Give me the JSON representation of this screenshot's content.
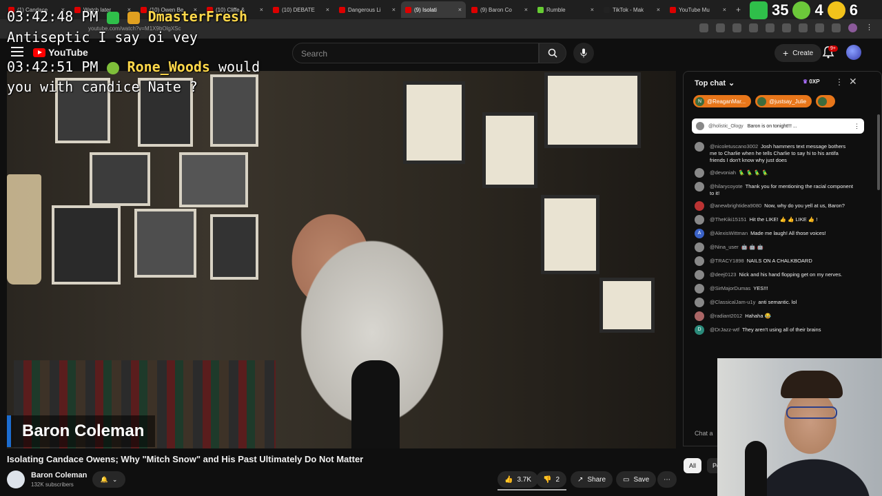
{
  "tabs": [
    {
      "label": "(1) Candace",
      "color": "#d00"
    },
    {
      "label": "Watch later",
      "color": "#d00"
    },
    {
      "label": "(10) Owen Be",
      "color": "#d00"
    },
    {
      "label": "(10) Cliffe &",
      "color": "#d00"
    },
    {
      "label": "(10) DEBATE",
      "color": "#d00"
    },
    {
      "label": "Dangerous Li",
      "color": "#d00"
    },
    {
      "label": "(9) Isolati",
      "color": "#d00",
      "active": true
    },
    {
      "label": "(9) Baron Co",
      "color": "#d00"
    },
    {
      "label": "Rumble",
      "color": "#6c3"
    },
    {
      "label": "TikTok - Mak",
      "color": "#222"
    },
    {
      "label": "YouTube Mu",
      "color": "#d00"
    }
  ],
  "browser": {
    "url": "youtube.com/watch?v=M1X9bOlgXSc",
    "new_tab": "+"
  },
  "youtube": {
    "logo": "YouTube",
    "search_placeholder": "Search",
    "create_label": "Create",
    "notif_count": "9+"
  },
  "overlay": {
    "time1": "03:42:48 PM",
    "user1": "DmasterFresh",
    "msg1": "Antiseptic I say oi vey",
    "time2": "03:42:51 PM",
    "user2": "Rone_Woods",
    "msg2a": "would",
    "msg2b": "you with candice Nate ?"
  },
  "stats": {
    "v1": "35",
    "v2": "4",
    "v3": "6"
  },
  "video": {
    "lower_third": "Baron Coleman",
    "title": "Isolating Candace Owens; Why \"Mitch Snow\" and His Past Ultimately Do Not Matter"
  },
  "channel": {
    "name": "Baron Coleman",
    "subs": "132K subscribers"
  },
  "actions": {
    "likes": "3.7K",
    "dislikes": "2",
    "share": "Share",
    "save": "Save"
  },
  "chat": {
    "header": "Top chat",
    "xp": "0XP",
    "tickers": [
      {
        "name": "@ReaganMar...",
        "initial": "N",
        "color": "#e8761a"
      },
      {
        "name": "@justsay_Julie",
        "initial": "",
        "color": "#e8761a"
      },
      {
        "name": "",
        "initial": "",
        "color": "#e8761a"
      }
    ],
    "pinned": {
      "user": "@holistic_Ology",
      "text": "Baron is on tonight!!! ..."
    },
    "messages": [
      {
        "user": "@nicoletuscano3002",
        "text": "Josh hammers text message bothers me to Charlie when he tells Charlie to say hi to his antifa friends I don't know why just does",
        "avc": "#888"
      },
      {
        "user": "@devoniah",
        "text": "🦜 🦜 🦜 🦜",
        "avc": "#888"
      },
      {
        "user": "@hilarycoyote",
        "text": "Thank you for mentioning the racial component to it!",
        "avc": "#888"
      },
      {
        "user": "@anewbrightidea9080",
        "text": "Now, why do you yell at us, Baron?",
        "avc": "#b33"
      },
      {
        "user": "@TheKiki15151",
        "text": "Hit the LIKE! 👍 👍 LIKE 👍 !",
        "avc": "#888"
      },
      {
        "user": "@AlexisWittman",
        "text": "Made me laugh! All those voices!",
        "avc": "#3a62c7",
        "initial": "A"
      },
      {
        "user": "@Nina_user",
        "text": "🤖 🤖 🤖",
        "avc": "#888"
      },
      {
        "user": "@TRACY1898",
        "text": "NAILS ON A CHALKBOARD",
        "avc": "#888"
      },
      {
        "user": "@deej0123",
        "text": "Nick and his hand flopping get on my nerves.",
        "avc": "#888"
      },
      {
        "user": "@SirMajorDumas",
        "text": "YES!!!",
        "avc": "#888"
      },
      {
        "user": "@ClassicalJam-u1y",
        "text": "anti semantic. lol",
        "avc": "#888"
      },
      {
        "user": "@radiant2012",
        "text": "Hahaha 😂",
        "avc": "#a66"
      },
      {
        "user": "@DrJazz-wtf",
        "text": "They aren't using all of their brains",
        "avc": "#2a8a7a",
        "initial": "D"
      }
    ],
    "input_placeholder": "Chat a",
    "chips": [
      "All",
      "Po"
    ]
  }
}
